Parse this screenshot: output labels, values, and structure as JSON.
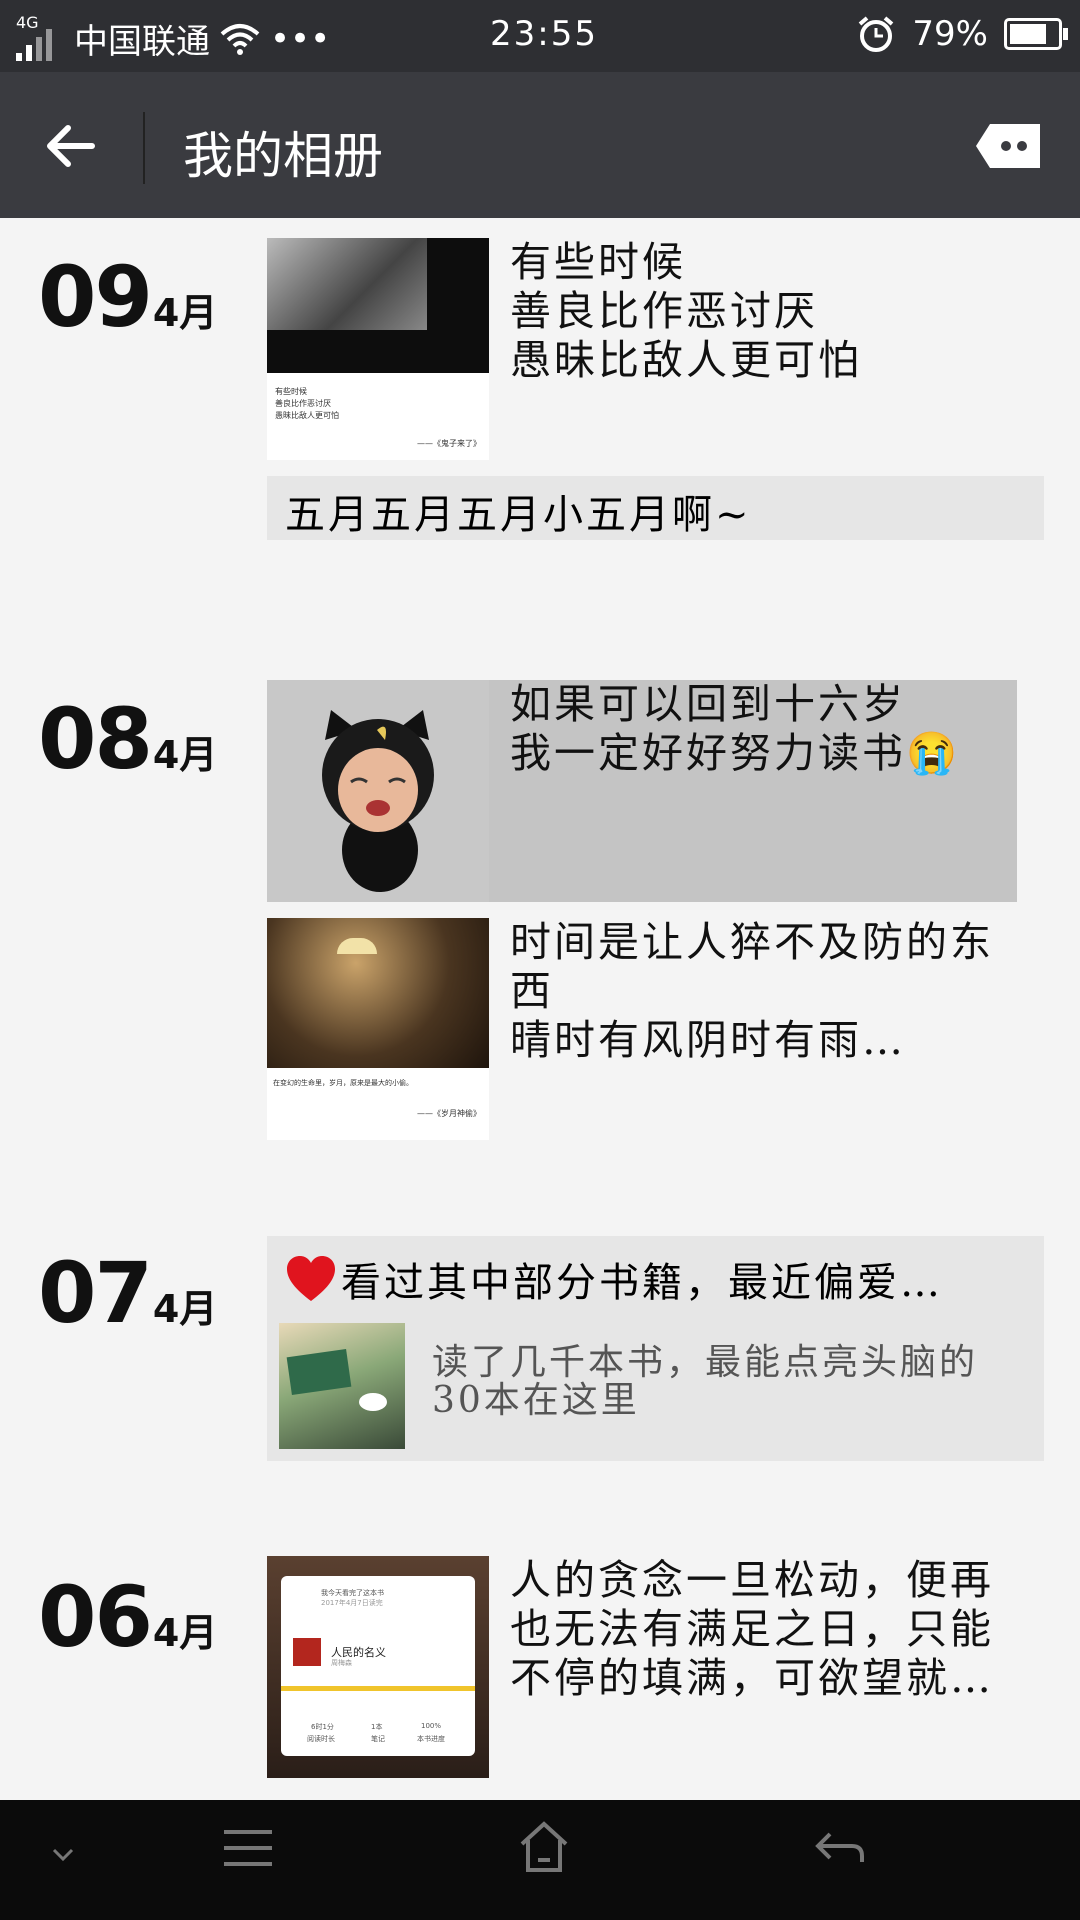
{
  "status_bar": {
    "network": "4G",
    "carrier": "中国联通",
    "dots": "•••",
    "time": "23:55",
    "battery": "79%",
    "battery_level": 0.79
  },
  "header": {
    "title": "我的相册"
  },
  "posts": [
    {
      "day": "09",
      "month": "4月",
      "image_text": [
        "有些时候",
        "善良比作恶讨厌",
        "愚昧比敌人更可怕"
      ],
      "image_caption": "——《鬼子来了》",
      "text": [
        "有些时候",
        "善良比作恶讨厌",
        "愚昧比敌人更可怕"
      ],
      "status_text": "五月五月五月小五月啊~"
    },
    {
      "day": "08",
      "month": "4月",
      "text": [
        "如果可以回到十六岁",
        "我一定好好努力读书😭"
      ],
      "image_text": "在变幻的生命里，岁月，原来是最大的小偷。",
      "image_caption": "——《岁月神偷》",
      "text2": [
        "时间是让人猝不及防的东",
        "西",
        "晴时有风阴时有雨…"
      ]
    },
    {
      "day": "07",
      "month": "4月",
      "share_title": "看过其中部分书籍，最近偏爱…",
      "share_desc": [
        "读了几千本书，最能点亮头脑的",
        "30本在这里"
      ]
    },
    {
      "day": "06",
      "month": "4月",
      "image_text": [
        "我今天看完了这本书",
        "2017年4月7日读完",
        "人民的名义",
        "周梅森",
        "6时1分",
        "1本",
        "100%",
        "阅读时长",
        "笔记",
        "本书进度"
      ],
      "text": [
        "人的贪念一旦松动，便再",
        "也无法有满足之日，只能",
        "不停的填满，可欲望就…"
      ]
    }
  ]
}
